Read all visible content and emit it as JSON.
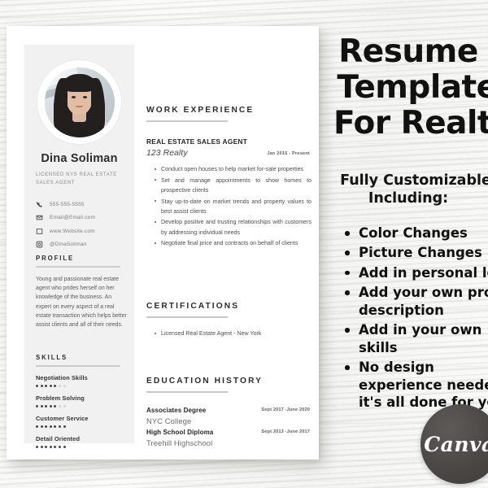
{
  "resume": {
    "sidebar": {
      "photo_alt": "portrait photo of Dina Soliman",
      "name": "Dina Soliman",
      "role": "LICENSED NYS REAL ESTATE SALES AGENT",
      "contacts": [
        {
          "icon": "phone-icon",
          "text": "555-555-5555"
        },
        {
          "icon": "email-icon",
          "text": "Email@Email.com"
        },
        {
          "icon": "website-icon",
          "text": "www.Website.com"
        },
        {
          "icon": "social-icon",
          "text": "@DinaSoliman"
        }
      ],
      "profile": {
        "heading": "PROFILE",
        "text": "Young and passionate real estate agent who prides herself on her knowledge of the business. An expert on every aspect of a real estate transaction which helps better assist clients and all of their needs."
      },
      "skills": {
        "heading": "SKILLS",
        "max_dots": 7,
        "items": [
          {
            "name": "Negotiation Skills",
            "level": 5
          },
          {
            "name": "Problem Solving",
            "level": 5
          },
          {
            "name": "Customer Service",
            "level": 7
          },
          {
            "name": "Detail Oriented",
            "level": 7
          }
        ]
      }
    },
    "main": {
      "work_experience": {
        "heading": "WORK EXPERIENCE",
        "job_title": "REAL ESTATE SALES AGENT",
        "company": "123 Realty",
        "dates": "Jan 2015 - Present",
        "bullets": [
          "Conduct open houses to help market for-sale properties",
          "Set and manage appointments to show homes to prospective clients",
          "Stay up-to-date on market trends and property values to best assist clients",
          "Develop positive and trusting relationships with customers by addressing individual needs",
          "Negotiate final price and contracts on behalf of clients"
        ]
      },
      "certifications": {
        "heading": "CERTIFICATIONS",
        "bullets": [
          "Licensed Real Estate Agent - New York"
        ]
      },
      "education": {
        "heading": "EDUCATION HISTORY",
        "entries": [
          {
            "degree": "Associates Degree",
            "school": "NYC College",
            "dates": "Sept 2017 -June 2020"
          },
          {
            "degree": "High School Diploma",
            "school": "Treehill Highschool",
            "dates": "Sept 2013 -June 2017"
          }
        ]
      }
    }
  },
  "promo": {
    "title_line1": "Resume",
    "title_line2": "Template",
    "title_line3": "For Realtor",
    "subtitle_line1": "Fully Customizable",
    "subtitle_line2": "Including:",
    "features": [
      "Color Changes",
      "Picture Changes",
      "Add in personal logo",
      "Add your own profile description",
      "Add in your own skills",
      "No design experience needed, it's all done for you!"
    ],
    "badge_label": "Canva"
  }
}
